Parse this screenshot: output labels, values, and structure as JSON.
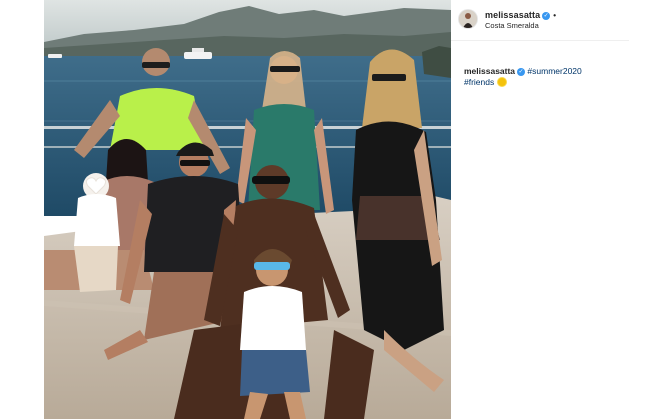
{
  "post": {
    "username": "melissasatta",
    "location": "Costa Smeralda",
    "caption_user": "melissasatta",
    "hashtags": [
      "#summer2020",
      "#friends"
    ],
    "verified": true,
    "emoji": "sun"
  },
  "colors": {
    "accent": "#3897f0",
    "hashtag": "#003569",
    "text": "#262626"
  }
}
